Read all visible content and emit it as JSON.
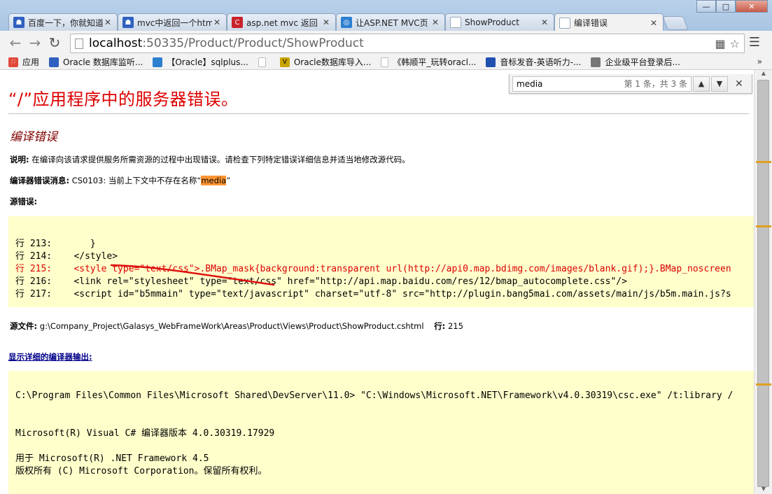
{
  "tabs": [
    {
      "title": "百度一下，你就知道",
      "icon": "baidu-paw-icon",
      "color": "#3060c0"
    },
    {
      "title": "mvc中返回一个htm",
      "icon": "baidu-paw-icon",
      "color": "#3060c0"
    },
    {
      "title": "asp.net mvc 返回",
      "icon": "csdn-c-icon",
      "color": "#c8232c"
    },
    {
      "title": "让ASP.NET MVC页",
      "icon": "globe-icon",
      "color": "#2d7fd0"
    },
    {
      "title": "ShowProduct",
      "icon": "page-icon",
      "color": "#9aa8b8"
    },
    {
      "title": "编译错误",
      "icon": "page-icon",
      "color": "#9aa8b8",
      "active": true
    }
  ],
  "address": {
    "host": "localhost",
    "path": ":50335/Product/Product/ShowProduct"
  },
  "bookmarks": [
    {
      "label": "应用",
      "icon": "apps-grid-icon",
      "color": "#e04a3a"
    },
    {
      "label": "Oracle 数据库监听...",
      "icon": "baidu-paw-icon",
      "color": "#3060c0"
    },
    {
      "label": "【Oracle】sqlplus...",
      "icon": "globe-icon",
      "color": "#2d7fd0"
    },
    {
      "label": "",
      "icon": "page-icon",
      "color": "#bbbbbb"
    },
    {
      "label": "Oracle数据库导入...",
      "icon": "v-logo-icon",
      "color": "#caa400"
    },
    {
      "label": "《韩顺平_玩转oracl...",
      "icon": "page-icon",
      "color": "#bbbbbb"
    },
    {
      "label": "音标发音-英语听力-...",
      "icon": "bookmark-icon",
      "color": "#2050b0"
    },
    {
      "label": "企业级平台登录后...",
      "icon": "globe-icon",
      "color": "#777777"
    }
  ],
  "find": {
    "query": "media",
    "count": "第 1 条，共 3 条"
  },
  "page": {
    "title": "“/”应用程序中的服务器错误。",
    "section_title": "编译错误",
    "desc_label": "说明:",
    "desc_text": " 在编译向该请求提供服务所需资源的过程中出现错误。请检查下列特定错误详细信息并适当地修改源代码。",
    "compiler_label": "编译器错误消息:",
    "compiler_text": " CS0103: 当前上下文中不存在名称“",
    "compiler_highlight": "media",
    "compiler_end": "”",
    "source_error_label": "源错误:",
    "code_lines": [
      {
        "text": "行 213:       }",
        "error": false
      },
      {
        "text": "行 214:    </style>",
        "error": false
      },
      {
        "text": "行 215:    <style type=\"text/css\">.BMap_mask{background:transparent url(http://api0.map.bdimg.com/images/blank.gif);}.BMap_noscreen",
        "error": true
      },
      {
        "text": "行 216:    <link rel=\"stylesheet\" type=\"text/css\" href=\"http://api.map.baidu.com/res/12/bmap_autocomplete.css\"/>",
        "error": false
      },
      {
        "text": "行 217:    <script id=\"b5mmain\" type=\"text/javascript\" charset=\"utf-8\" src=\"http://plugin.bang5mai.com/assets/main/js/b5m.main.js?s",
        "error": false
      }
    ],
    "source_file_label": "源文件:",
    "source_file_path": " g:\\Company_Project\\Galasys_WebFrameWork\\Areas\\Product\\Views\\Product\\ShowProduct.cshtml",
    "line_label": "行:",
    "line_number": " 215",
    "detail_link": "显示详细的编译器输出:",
    "output_lines": [
      "C:\\Program Files\\Common Files\\Microsoft Shared\\DevServer\\11.0> \"C:\\Windows\\Microsoft.NET\\Framework\\v4.0.30319\\csc.exe\" /t:library /",
      "",
      "",
      "Microsoft(R) Visual C# 编译器版本 4.0.30319.17929",
      "",
      "用于 Microsoft(R) .NET Framework 4.5",
      "版权所有 (C) Microsoft Corporation。保留所有权利。"
    ]
  }
}
